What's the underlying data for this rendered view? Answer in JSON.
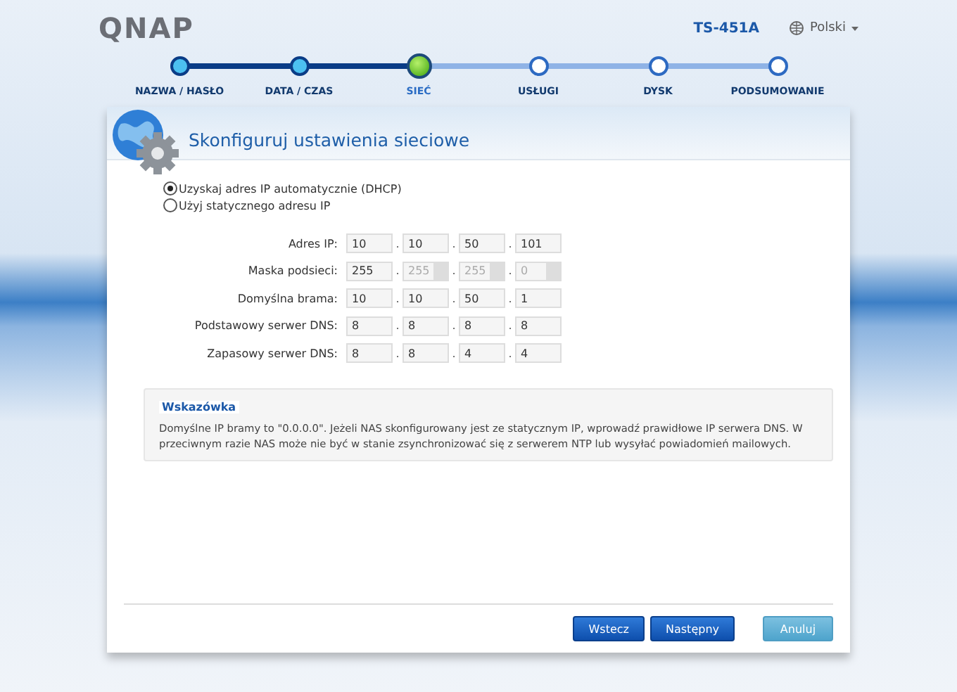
{
  "header": {
    "logo": "QNAP",
    "model": "TS-451A",
    "language": "Polski"
  },
  "steps": [
    {
      "label": "NAZWA / HASŁO",
      "kind": "done"
    },
    {
      "label": "DATA / CZAS",
      "kind": "done"
    },
    {
      "label": "SIEĆ",
      "kind": "current"
    },
    {
      "label": "USŁUGI",
      "kind": "todo"
    },
    {
      "label": "DYSK",
      "kind": "todo"
    },
    {
      "label": "PODSUMOWANIE",
      "kind": "todo"
    }
  ],
  "title": "Skonfiguruj ustawienia sieciowe",
  "ip_mode": [
    {
      "label": "Uzyskaj adres IP automatycznie (DHCP)",
      "selected": true
    },
    {
      "label": "Użyj statycznego adresu IP",
      "selected": false
    }
  ],
  "fields": [
    {
      "label": "Adres IP:",
      "octets": [
        {
          "value": "10",
          "kind": "input"
        },
        {
          "value": "10",
          "kind": "input"
        },
        {
          "value": "50",
          "kind": "input"
        },
        {
          "value": "101",
          "kind": "input"
        }
      ]
    },
    {
      "label": "Maska podsieci:",
      "octets": [
        {
          "value": "255",
          "kind": "input"
        },
        {
          "value": "255",
          "kind": "select"
        },
        {
          "value": "255",
          "kind": "select"
        },
        {
          "value": "0",
          "kind": "select"
        }
      ]
    },
    {
      "label": "Domyślna brama:",
      "octets": [
        {
          "value": "10",
          "kind": "input"
        },
        {
          "value": "10",
          "kind": "input"
        },
        {
          "value": "50",
          "kind": "input"
        },
        {
          "value": "1",
          "kind": "input"
        }
      ]
    },
    {
      "label": "Podstawowy serwer DNS:",
      "octets": [
        {
          "value": "8",
          "kind": "input"
        },
        {
          "value": "8",
          "kind": "input"
        },
        {
          "value": "8",
          "kind": "input"
        },
        {
          "value": "8",
          "kind": "input"
        }
      ]
    },
    {
      "label": "Zapasowy serwer DNS:",
      "octets": [
        {
          "value": "8",
          "kind": "input"
        },
        {
          "value": "8",
          "kind": "input"
        },
        {
          "value": "4",
          "kind": "input"
        },
        {
          "value": "4",
          "kind": "input"
        }
      ]
    }
  ],
  "separator": ".",
  "hint": {
    "title": "Wskazówka",
    "text": "Domyślne IP bramy to \"0.0.0.0\". Jeżeli NAS skonfigurowany jest ze statycznym IP, wprowadź prawidłowe IP serwera DNS. W przeciwnym razie NAS może nie być w stanie zsynchronizować się z serwerem NTP lub wysyłać powiadomień mailowych."
  },
  "buttons": [
    {
      "label": "Wstecz",
      "kind": "primary"
    },
    {
      "label": "Następny",
      "kind": "primary"
    },
    {
      "label": "Anuluj",
      "kind": "secondary"
    }
  ]
}
